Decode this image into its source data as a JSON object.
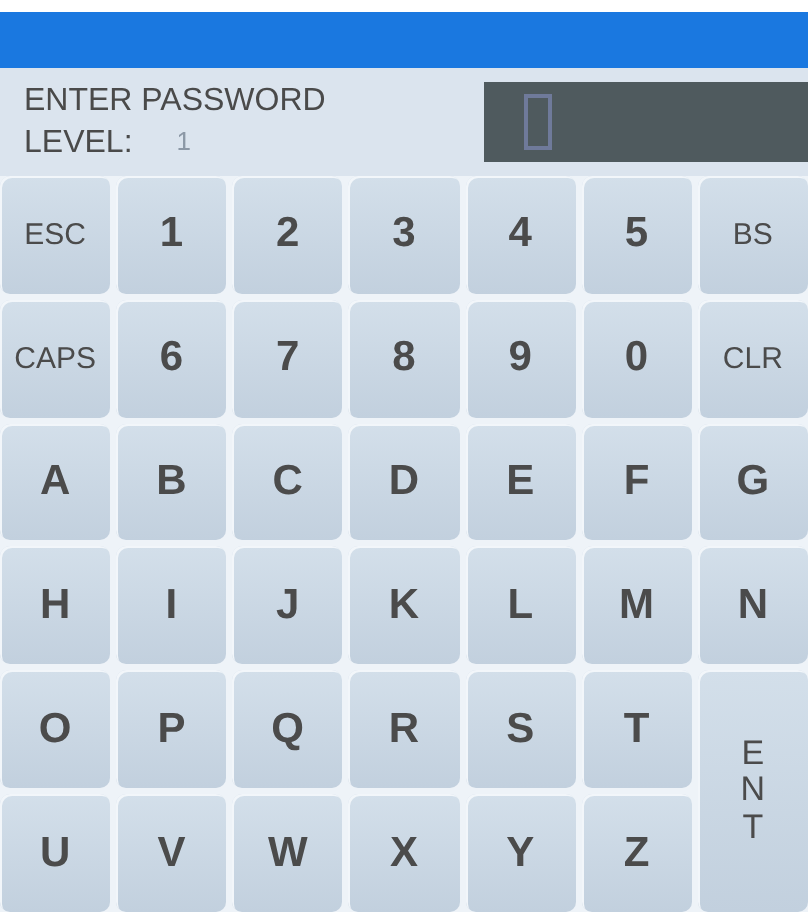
{
  "header": {
    "prompt": "ENTER PASSWORD",
    "level_label": "LEVEL:",
    "level_value": "1"
  },
  "keys": [
    [
      {
        "label": "ESC",
        "kind": "function"
      },
      {
        "label": "1",
        "kind": "char"
      },
      {
        "label": "2",
        "kind": "char"
      },
      {
        "label": "3",
        "kind": "char"
      },
      {
        "label": "4",
        "kind": "char"
      },
      {
        "label": "5",
        "kind": "char"
      },
      {
        "label": "BS",
        "kind": "function"
      }
    ],
    [
      {
        "label": "CAPS",
        "kind": "function"
      },
      {
        "label": "6",
        "kind": "char"
      },
      {
        "label": "7",
        "kind": "char"
      },
      {
        "label": "8",
        "kind": "char"
      },
      {
        "label": "9",
        "kind": "char"
      },
      {
        "label": "0",
        "kind": "char"
      },
      {
        "label": "CLR",
        "kind": "function"
      }
    ],
    [
      {
        "label": "A",
        "kind": "char"
      },
      {
        "label": "B",
        "kind": "char"
      },
      {
        "label": "C",
        "kind": "char"
      },
      {
        "label": "D",
        "kind": "char"
      },
      {
        "label": "E",
        "kind": "char"
      },
      {
        "label": "F",
        "kind": "char"
      },
      {
        "label": "G",
        "kind": "char"
      }
    ],
    [
      {
        "label": "H",
        "kind": "char"
      },
      {
        "label": "I",
        "kind": "char"
      },
      {
        "label": "J",
        "kind": "char"
      },
      {
        "label": "K",
        "kind": "char"
      },
      {
        "label": "L",
        "kind": "char"
      },
      {
        "label": "M",
        "kind": "char"
      },
      {
        "label": "N",
        "kind": "char"
      }
    ],
    [
      {
        "label": "O",
        "kind": "char"
      },
      {
        "label": "P",
        "kind": "char"
      },
      {
        "label": "Q",
        "kind": "char"
      },
      {
        "label": "R",
        "kind": "char"
      },
      {
        "label": "S",
        "kind": "char"
      },
      {
        "label": "T",
        "kind": "char"
      },
      {
        "label": "ENT",
        "kind": "tall"
      }
    ],
    [
      {
        "label": "U",
        "kind": "char"
      },
      {
        "label": "V",
        "kind": "char"
      },
      {
        "label": "W",
        "kind": "char"
      },
      {
        "label": "X",
        "kind": "char"
      },
      {
        "label": "Y",
        "kind": "char"
      },
      {
        "label": "Z",
        "kind": "char"
      }
    ]
  ]
}
